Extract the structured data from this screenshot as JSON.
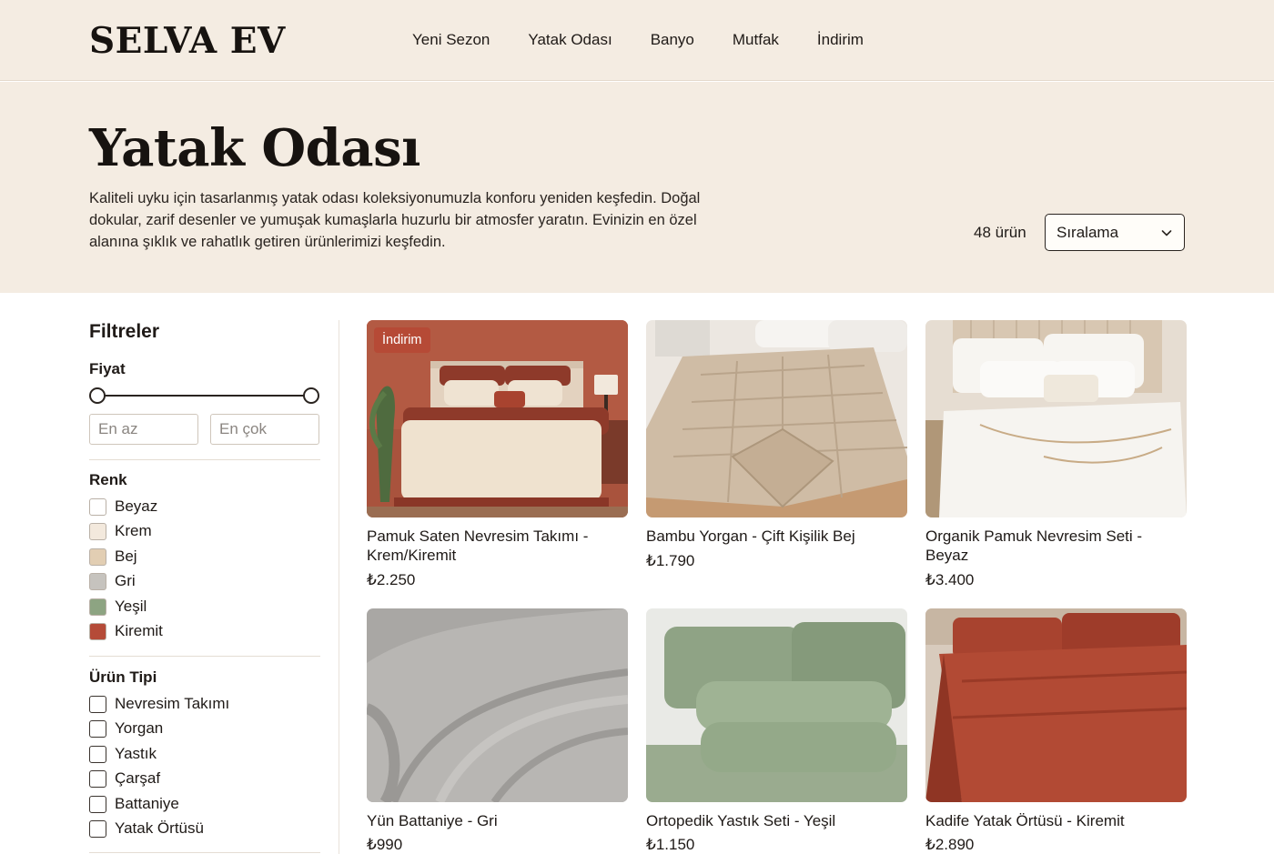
{
  "brand": "SELVA EV",
  "nav": [
    "Yeni Sezon",
    "Yatak Odası",
    "Banyo",
    "Mutfak",
    "İndirim"
  ],
  "hero": {
    "title": "Yatak Odası",
    "description": "Kaliteli uyku için tasarlanmış yatak odası koleksiyonumuzla konforu yeniden keşfedin. Doğal dokular, zarif desenler ve yumuşak kumaşlarla huzurlu bir atmosfer yaratın. Evinizin en özel alanına şıklık ve rahatlık getiren ürünlerimizi keşfedin.",
    "count": "48 ürün",
    "sort_label": "Sıralama"
  },
  "filters": {
    "title": "Filtreler",
    "price": {
      "heading": "Fiyat",
      "min_placeholder": "En az",
      "max_placeholder": "En çok"
    },
    "color": {
      "heading": "Renk",
      "options": [
        {
          "label": "Beyaz",
          "swatch": "#ffffff"
        },
        {
          "label": "Krem",
          "swatch": "#f3e9dd"
        },
        {
          "label": "Bej",
          "swatch": "#e2ceb3"
        },
        {
          "label": "Gri",
          "swatch": "#c6c3be"
        },
        {
          "label": "Yeşil",
          "swatch": "#8da482"
        },
        {
          "label": "Kiremit",
          "swatch": "#b54b38"
        }
      ]
    },
    "type": {
      "heading": "Ürün Tipi",
      "options": [
        "Nevresim Takımı",
        "Yorgan",
        "Yastık",
        "Çarşaf",
        "Battaniye",
        "Yatak Örtüsü"
      ]
    }
  },
  "products": [
    {
      "name": "Pamuk Saten Nevresim Takımı - Krem/Kiremit",
      "price": "₺2.250",
      "badge": "İndirim",
      "image": "bedroom-cream-terracotta-bedding"
    },
    {
      "name": "Bambu Yorgan - Çift Kişilik Bej",
      "price": "₺1.790",
      "badge": "",
      "image": "beige-quilted-duvet"
    },
    {
      "name": "Organik Pamuk Nevresim Seti - Beyaz",
      "price": "₺3.400",
      "badge": "",
      "image": "white-embroidered-bedding"
    },
    {
      "name": "Yün Battaniye - Gri",
      "price": "₺990",
      "badge": "",
      "image": "grey-wool-blanket"
    },
    {
      "name": "Ortopedik Yastık Seti - Yeşil",
      "price": "₺1.150",
      "badge": "",
      "image": "green-pillows"
    },
    {
      "name": "Kadife Yatak Örtüsü - Kiremit",
      "price": "₺2.890",
      "badge": "",
      "image": "terracotta-velvet-bedspread"
    }
  ],
  "colors": {
    "background": "#f4ece2",
    "accent": "#b64a36",
    "text": "#1f1a17"
  }
}
